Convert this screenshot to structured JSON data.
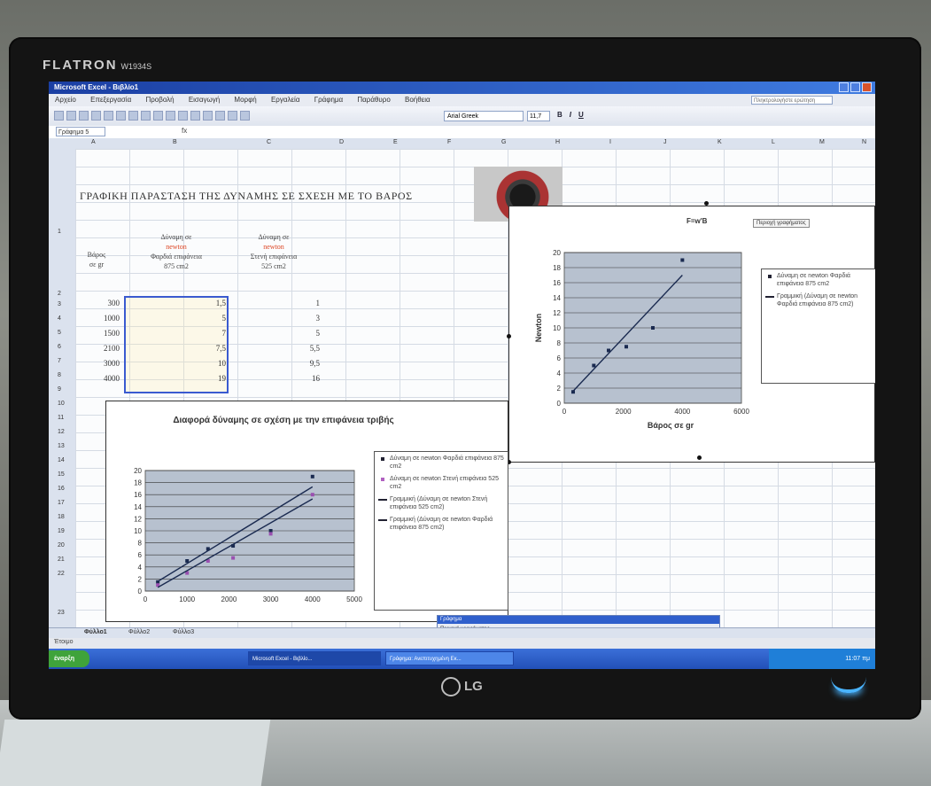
{
  "monitor": {
    "brand": "FLATRON",
    "model": "W1934S",
    "logo": "LG"
  },
  "window": {
    "title": "Microsoft Excel - Βιβλίο1",
    "help_placeholder": "Πληκτρολογήστε ερώτηση"
  },
  "menu": [
    "Αρχείο",
    "Επεξεργασία",
    "Προβολή",
    "Εισαγωγή",
    "Μορφή",
    "Εργαλεία",
    "Γράφημα",
    "Παράθυρο",
    "Βοήθεια"
  ],
  "toolbar": {
    "font": "Arial Greek",
    "size": "11,7",
    "bold": "B",
    "italic": "I",
    "underline": "U"
  },
  "formula_bar": {
    "name_box": "Γράφημα 5",
    "fx": "fx"
  },
  "columns": [
    "A",
    "B",
    "C",
    "D",
    "E",
    "F",
    "G",
    "H",
    "I",
    "J",
    "K",
    "L",
    "M",
    "N"
  ],
  "rows": [
    "1",
    "2",
    "3",
    "4",
    "5",
    "6",
    "7",
    "8",
    "9",
    "10",
    "11",
    "12",
    "13",
    "14",
    "15",
    "16",
    "17",
    "18",
    "19",
    "20",
    "21",
    "22",
    "23"
  ],
  "sheet": {
    "title": "ΓΡΑΦΙΚΗ ΠΑΡΑΣΤΑΣΗ ΤΗΣ ΔΥΝΑΜΗΣ ΣΕ ΣΧΕΣΗ ΜΕ ΤΟ ΒΑΡΟΣ",
    "header_weight_1": "Βάρος",
    "header_weight_2": "σε gr",
    "header_b_1": "Δύναμη σε",
    "header_b_2": "newton",
    "header_b_3": "Φαρδιά επιφάνεια",
    "header_b_4": "875 cm2",
    "header_c_1": "Δύναμη σε",
    "header_c_2": "newton",
    "header_c_3": "Στενή επιφάνεια",
    "header_c_4": "525 cm2",
    "data": [
      {
        "weight": "300",
        "wide": "1,5",
        "narrow": "1"
      },
      {
        "weight": "1000",
        "wide": "5",
        "narrow": "3"
      },
      {
        "weight": "1500",
        "wide": "7",
        "narrow": "5"
      },
      {
        "weight": "2100",
        "wide": "7,5",
        "narrow": "5,5"
      },
      {
        "weight": "3000",
        "wide": "10",
        "narrow": "9,5"
      },
      {
        "weight": "4000",
        "wide": "19",
        "narrow": "16"
      }
    ]
  },
  "chart_data": [
    {
      "type": "scatter",
      "title": "F=w'B",
      "xlabel": "Βάρος σε gr",
      "ylabel": "Newton",
      "xlim": [
        0,
        6000
      ],
      "ylim": [
        0,
        20
      ],
      "x_ticks": [
        "0",
        "2000",
        "4000",
        "6000"
      ],
      "y_ticks": [
        "0",
        "2",
        "4",
        "6",
        "8",
        "10",
        "12",
        "14",
        "16",
        "18",
        "20"
      ],
      "series": [
        {
          "name": "Δύναμη σε newton Φαρδιά επιφάνεια 875 cm2",
          "x": [
            300,
            1000,
            1500,
            2100,
            3000,
            4000
          ],
          "y": [
            1.5,
            5,
            7,
            7.5,
            10,
            19
          ]
        },
        {
          "name": "Γραμμική (Δύναμη σε newton Φαρδιά επιφάνεια 875 cm2)",
          "type": "trendline",
          "x": [
            300,
            4000
          ],
          "y": [
            1.6,
            17
          ]
        }
      ],
      "legend_placement": "right",
      "button_label": "Περιοχή γραφήματος"
    },
    {
      "type": "scatter",
      "title": "Διαφορά δύναμης σε σχέση με την επιφάνεια τριβής",
      "xlabel": "",
      "ylabel": "",
      "xlim": [
        0,
        5000
      ],
      "ylim": [
        0,
        20
      ],
      "x_ticks": [
        "0",
        "1000",
        "2000",
        "3000",
        "4000",
        "5000"
      ],
      "y_ticks": [
        "0",
        "2",
        "4",
        "6",
        "8",
        "10",
        "12",
        "14",
        "16",
        "18",
        "20"
      ],
      "series": [
        {
          "name": "Δύναμη σε newton Φαρδιά επιφάνεια 875 cm2",
          "x": [
            300,
            1000,
            1500,
            2100,
            3000,
            4000
          ],
          "y": [
            1.5,
            5,
            7,
            7.5,
            10,
            19
          ]
        },
        {
          "name": "Δύναμη σε newton Στενή επιφάνεια 525 cm2",
          "x": [
            300,
            1000,
            1500,
            2100,
            3000,
            4000
          ],
          "y": [
            1,
            3,
            5,
            5.5,
            9.5,
            16
          ]
        },
        {
          "name": "Γραμμική (Δύναμη σε newton Στενή επιφάνεια 525 cm2)",
          "type": "trendline",
          "x": [
            300,
            4000
          ],
          "y": [
            0.6,
            15.3
          ]
        },
        {
          "name": "Γραμμική (Δύναμη σε newton Φαρδιά επιφάνεια 875 cm2)",
          "type": "trendline",
          "x": [
            300,
            4000
          ],
          "y": [
            1.6,
            17.3
          ]
        }
      ],
      "legend_placement": "right"
    }
  ],
  "sheet_tabs": [
    "Φύλλο1",
    "Φύλλο2",
    "Φύλλο3"
  ],
  "status": {
    "left": "Έτοιμο"
  },
  "float_panel": {
    "title": "Γράφημα",
    "label": "Περιοχή γραφήματος"
  },
  "taskbar": {
    "start": "έναρξη",
    "tasks": [
      "Microsoft Excel - Βιβλίο...",
      "Γράφημα: Ανεπιτυχημένη Εκ..."
    ],
    "clock": "11:07 πμ"
  }
}
